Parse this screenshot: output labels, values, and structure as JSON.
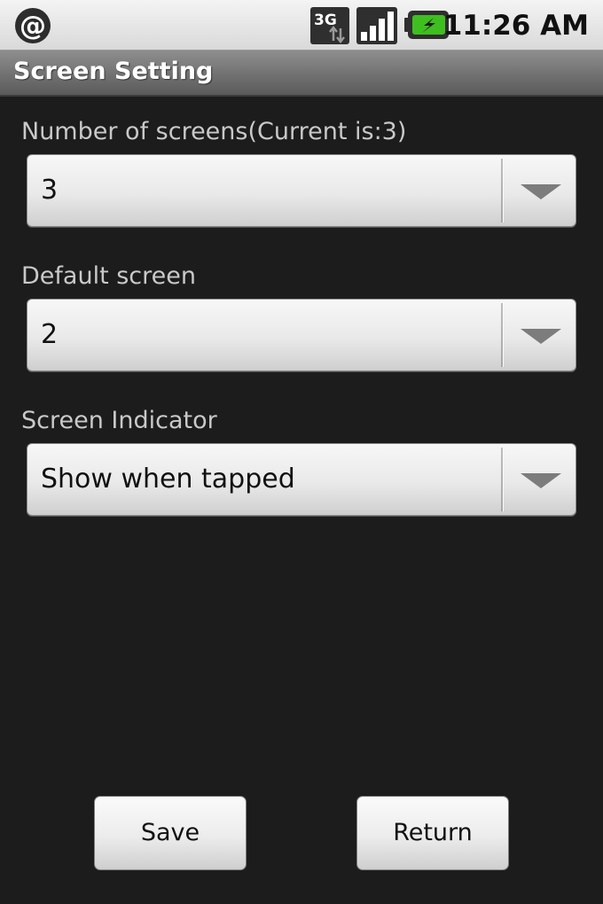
{
  "status_bar": {
    "time": "11:26 AM",
    "network_label": "3G",
    "icons": [
      "at-sign-icon",
      "3g-data-icon",
      "signal-strength-icon",
      "battery-charging-icon"
    ]
  },
  "title_bar": {
    "title": "Screen Setting"
  },
  "form": {
    "screens_count": {
      "label": "Number of screens(Current is:3)",
      "value": "3"
    },
    "default_screen": {
      "label": "Default screen",
      "value": "2"
    },
    "indicator": {
      "label": "Screen Indicator",
      "value": "Show when tapped"
    }
  },
  "buttons": {
    "save": "Save",
    "return": "Return"
  },
  "colors": {
    "background": "#1c1c1c",
    "battery_green": "#3fbf1f",
    "label_text": "#c9c9c9"
  }
}
